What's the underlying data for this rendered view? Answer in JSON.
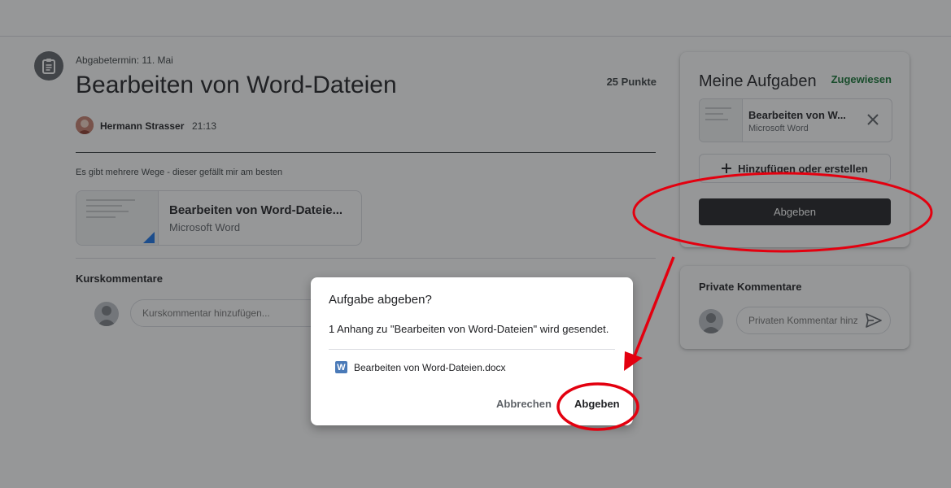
{
  "assignment": {
    "due": "Abgabetermin: 11. Mai",
    "title": "Bearbeiten von Word-Dateien",
    "points": "25 Punkte",
    "author": "Hermann Strasser",
    "time": "21:13",
    "description": "Es gibt mehrere Wege - dieser gefällt mir am besten",
    "attachment": {
      "name": "Bearbeiten von Word-Dateie...",
      "type": "Microsoft Word"
    }
  },
  "course_comments": {
    "heading": "Kurskommentare",
    "placeholder": "Kurskommentar hinzufügen..."
  },
  "my_tasks": {
    "title": "Meine Aufgaben",
    "status": "Zugewiesen",
    "file": {
      "name": "Bearbeiten von W...",
      "type": "Microsoft Word"
    },
    "add_label": "Hinzufügen oder erstellen",
    "submit_label": "Abgeben"
  },
  "private_comments": {
    "heading": "Private Kommentare",
    "placeholder": "Privaten Kommentar hinz"
  },
  "dialog": {
    "title": "Aufgabe abgeben?",
    "message": "1 Anhang zu \"Bearbeiten von Word-Dateien\" wird gesendet.",
    "file_icon_letter": "W",
    "file_name": "Bearbeiten von Word-Dateien.docx",
    "cancel_label": "Abbrechen",
    "submit_label": "Abgeben"
  },
  "colors": {
    "status_green": "#137333",
    "dark_button": "#202124",
    "annotation_red": "#e3000f",
    "word_blue": "#4a7ab8"
  }
}
